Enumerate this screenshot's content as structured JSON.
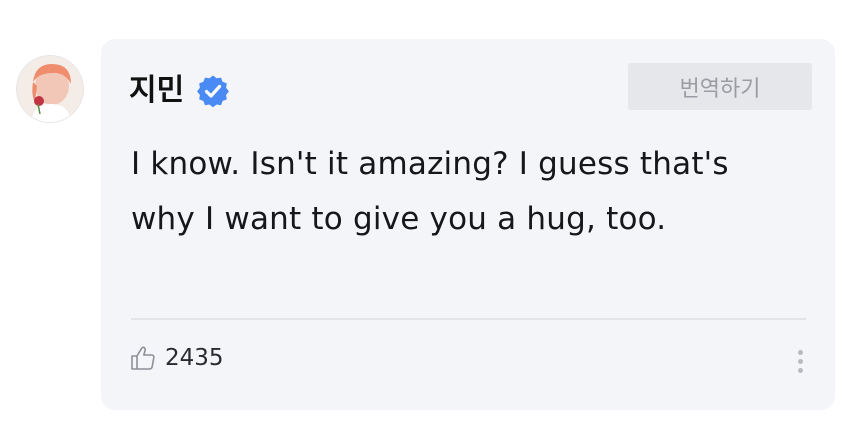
{
  "comment": {
    "author": "지민",
    "verified_icon": "verified-badge-icon",
    "translate_label": "번역하기",
    "text": "I know. Isn't it amazing? I guess that's why I want to give you a hug, too.",
    "like_icon": "thumbs-up-icon",
    "like_count": "2435",
    "more_icon": "more-vertical-icon"
  },
  "colors": {
    "card_background": "#f4f5f8",
    "verified_blue": "#4a8af4",
    "translate_button": "#e6e7eb",
    "text": "#16171a"
  }
}
